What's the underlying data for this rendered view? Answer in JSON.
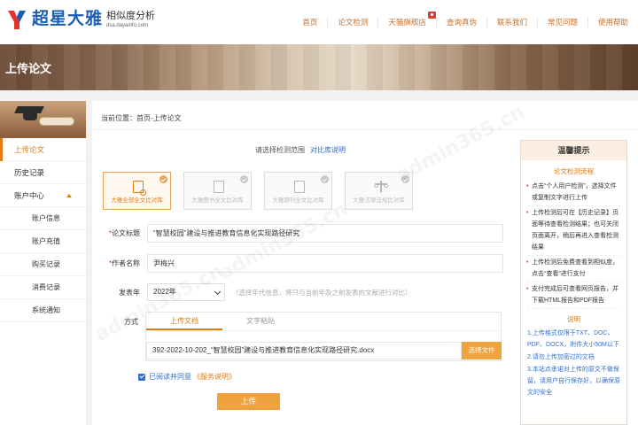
{
  "brand": {
    "name": "超星大雅",
    "tagline": "相似度分析",
    "domain": "dsa.dayainfo.com",
    "primary_color": "#1a5fb4",
    "accent_color": "#e27b12"
  },
  "nav": {
    "items": [
      "首页",
      "论文检测",
      "天猫旗舰店",
      "查询真伪",
      "联系我们",
      "常见问题",
      "使用帮助"
    ]
  },
  "banner": {
    "title": "上传论文"
  },
  "sidebar": {
    "items": [
      {
        "label": "上传论文"
      },
      {
        "label": "历史记录"
      },
      {
        "label": "账户中心"
      },
      {
        "label": "账户信息"
      },
      {
        "label": "账户充值"
      },
      {
        "label": "购买记录"
      },
      {
        "label": "消费记录"
      },
      {
        "label": "系统通知"
      }
    ]
  },
  "breadcrumb": "当前位置：首页-上传论文",
  "scope": {
    "label": "请选择检测范围",
    "link": "对比库说明"
  },
  "databases": [
    {
      "label": "大雅全部全文比对库",
      "selected": true
    },
    {
      "label": "大雅图书全文比对库",
      "selected": false
    },
    {
      "label": "大雅期刊全文比对库",
      "selected": false
    },
    {
      "label": "大雅法律法规比对库",
      "selected": false
    }
  ],
  "form": {
    "title_label": "论文标题",
    "title_value": "“智慧校园”建设与推进教育信息化实现路径研究",
    "author_label": "作者名称",
    "author_value": "尹梅兴",
    "year_label": "发表年",
    "year_value": "2022年",
    "year_hint": "（选择年代信息，将只与当前年及之前发表的文献进行对比）",
    "method_label": "方式",
    "tab_upload": "上传文档",
    "tab_paste": "文字粘贴",
    "file_value": "392-2022-10-202_“智慧校园”建设与推进教育信息化实现路径研究.docx",
    "file_button": "选择文件",
    "agree_text": "已阅读并同意",
    "agree_link": "《服务说明》",
    "submit": "上传"
  },
  "tips": {
    "title": "温馨提示",
    "flow_title": "论文检测流程",
    "steps": [
      "点击“个人用户检测”，选择文件或复制文字进行上传",
      "上传检测后可在【历史记录】页面等待查看检测结果；也可关闭页面离开，稍后再进入查看检测结果",
      "上传检测后免费查看到相似度，点击“查看”进行支付",
      "支付完成后可查看网页报告，并下载HTML报告和PDF报告"
    ],
    "notes_title": "说明",
    "notes": [
      "1.上传格式仅限于TXT、DOC、PDF、DOCX，附件大小50M以下",
      "2.请勿上传加密过的文档",
      "3.本站点承诺对上传的原文不做保留，请用户自行保存好，以确保原文的安全"
    ]
  },
  "watermark": "admin365.cn"
}
